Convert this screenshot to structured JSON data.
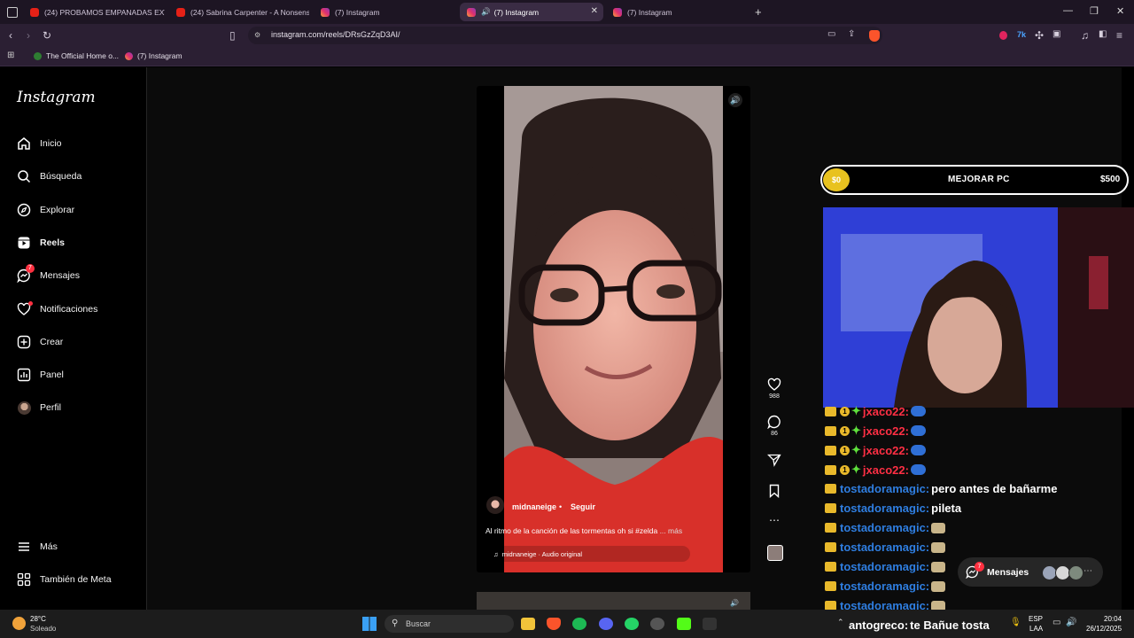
{
  "browser": {
    "tabs": [
      {
        "label": "(24) PROBAMOS EMPANADAS EXTR...",
        "favicon": "youtube-icon"
      },
      {
        "label": "(24) Sabrina Carpenter - A Nonsense...",
        "favicon": "youtube-icon"
      },
      {
        "label": "(7) Instagram",
        "favicon": "instagram-icon"
      },
      {
        "label": "(7) Instagram",
        "favicon": "instagram-icon",
        "active": true
      },
      {
        "label": "(7) Instagram",
        "favicon": "instagram-icon"
      }
    ],
    "url": "instagram.com/reels/DRsGzZqD3AI/",
    "bookmarks": [
      {
        "label": "The Official Home o..."
      },
      {
        "label": "(7) Instagram"
      }
    ]
  },
  "instagram": {
    "logo": "Instagram",
    "nav": [
      {
        "label": "Inicio",
        "icon": "home-icon"
      },
      {
        "label": "Búsqueda",
        "icon": "search-icon"
      },
      {
        "label": "Explorar",
        "icon": "compass-icon"
      },
      {
        "label": "Reels",
        "icon": "reels-icon",
        "active": true
      },
      {
        "label": "Mensajes",
        "icon": "messenger-icon",
        "badge": "7"
      },
      {
        "label": "Notificaciones",
        "icon": "heart-icon"
      },
      {
        "label": "Crear",
        "icon": "plus-square-icon"
      },
      {
        "label": "Panel",
        "icon": "chart-icon"
      },
      {
        "label": "Perfil",
        "icon": "avatar"
      }
    ],
    "more": {
      "label": "Más",
      "icon": "hamburger-icon"
    },
    "meta": {
      "label": "También de Meta",
      "icon": "meta-grid-icon"
    },
    "reel": {
      "author": "midnaneige",
      "separator": "•",
      "follow": "Seguir",
      "caption": "Al ritmo de la canción de las tormentas oh si #zelda",
      "more": "... más",
      "audio": "midnaneige · Audio original",
      "likes": "988",
      "comments": "86"
    },
    "messages_pill": {
      "label": "Mensajes",
      "badge": "7"
    }
  },
  "stream_overlay": {
    "goal": {
      "current": "$0",
      "title": "MEJORAR PC",
      "target": "$500"
    },
    "chat": [
      {
        "user": "jxaco22:",
        "text": "",
        "color": "red",
        "sub": "1"
      },
      {
        "user": "jxaco22:",
        "text": "",
        "color": "red",
        "sub": "1"
      },
      {
        "user": "jxaco22:",
        "text": "",
        "color": "red",
        "sub": "1"
      },
      {
        "user": "jxaco22:",
        "text": "",
        "color": "red",
        "sub": "1"
      },
      {
        "user": "tostadoramagic:",
        "text": "pero antes de bañarme",
        "color": "blue"
      },
      {
        "user": "tostadoramagic:",
        "text": "pileta",
        "color": "blue"
      },
      {
        "user": "tostadoramagic:",
        "text": "",
        "color": "blue"
      },
      {
        "user": "tostadoramagic:",
        "text": "",
        "color": "blue"
      },
      {
        "user": "tostadoramagic:",
        "text": "",
        "color": "blue"
      },
      {
        "user": "tostadoramagic:",
        "text": "",
        "color": "blue"
      },
      {
        "user": "tostadoramagic:",
        "text": "",
        "color": "blue"
      },
      {
        "user": "antogreco:",
        "text": "te Bañue tosta",
        "color": "white"
      }
    ]
  },
  "taskbar": {
    "weather_temp": "28°C",
    "weather_desc": "Soleado",
    "search_placeholder": "Buscar",
    "lang_top": "ESP",
    "lang_bottom": "LAA",
    "time": "20:04",
    "date": "26/12/2025"
  }
}
